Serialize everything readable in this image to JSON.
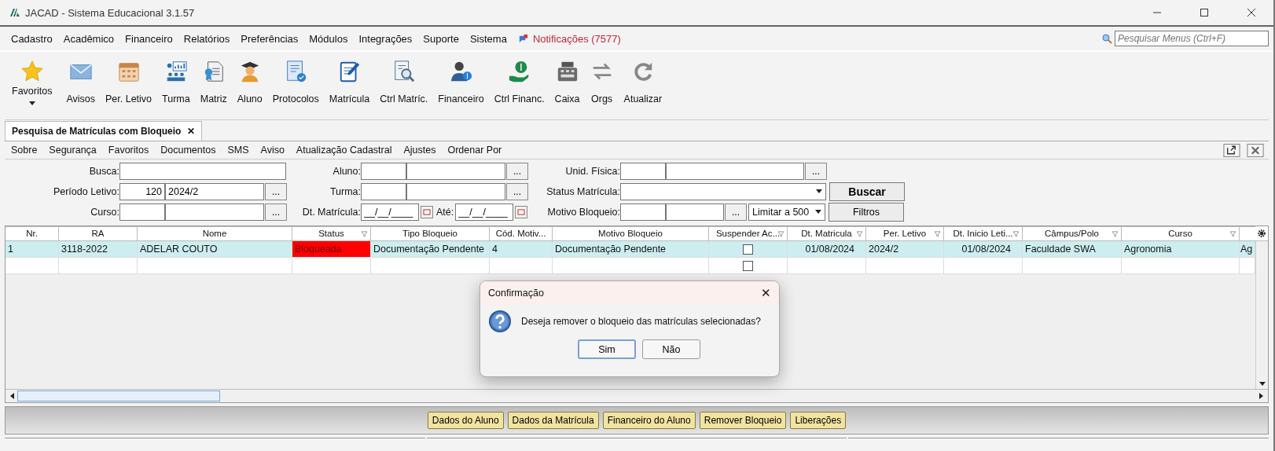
{
  "window": {
    "title": "JACAD - Sistema Educacional 3.1.57"
  },
  "menu": [
    "Cadastro",
    "Acadêmico",
    "Financeiro",
    "Relatórios",
    "Preferências",
    "Módulos",
    "Integrações",
    "Suporte",
    "Sistema"
  ],
  "notifications": "Notificações (7577)",
  "menu_search": {
    "placeholder": "Pesquisar Menus (Ctrl+F)"
  },
  "toolbar": [
    {
      "kind": "star",
      "label": "Favoritos"
    },
    {
      "kind": "mail",
      "label": "Avisos"
    },
    {
      "kind": "calendar",
      "label": "Per. Letivo"
    },
    {
      "kind": "class",
      "label": "Turma"
    },
    {
      "kind": "cert",
      "label": "Matriz"
    },
    {
      "kind": "student",
      "label": "Aluno"
    },
    {
      "kind": "doc",
      "label": "Protocolos"
    },
    {
      "kind": "sign",
      "label": "Matrícula"
    },
    {
      "kind": "inspect",
      "label": "Ctrl Matríc."
    },
    {
      "kind": "finance",
      "label": "Financeiro"
    },
    {
      "kind": "money",
      "label": "Ctrl Financ."
    },
    {
      "kind": "register",
      "label": "Caixa"
    },
    {
      "kind": "swap",
      "label": "Orgs"
    },
    {
      "kind": "refresh",
      "label": "Atualizar"
    }
  ],
  "document_tab": {
    "label": "Pesquisa de Matrículas com Bloqueio",
    "close": "✕"
  },
  "submenu": [
    "Sobre",
    "Segurança",
    "Favoritos",
    "Documentos",
    "SMS",
    "Aviso",
    "Atualização Cadastral",
    "Ajustes",
    "Ordenar Por"
  ],
  "filters": {
    "busca": {
      "label": "Busca:"
    },
    "periodo": {
      "label": "Período Letivo:",
      "code": "120",
      "value": "2024/2",
      "ellipsis": "..."
    },
    "curso": {
      "label": "Curso:",
      "ellipsis": "..."
    },
    "aluno": {
      "label": "Aluno:",
      "ellipsis": "..."
    },
    "turma": {
      "label": "Turma:",
      "ellipsis": "..."
    },
    "dt_matricula": {
      "label": "Dt. Matrícula:",
      "value": "__/__/____"
    },
    "ate": {
      "label": "Até:",
      "value": "__/__/____"
    },
    "unid_fisica": {
      "label": "Unid. Física:",
      "ellipsis": "..."
    },
    "status_matricula": {
      "label": "Status Matrícula:"
    },
    "motivo_bloqueio": {
      "label": "Motivo Bloqueio:",
      "ellipsis": "..."
    },
    "limit": {
      "value": "Limitar a 500"
    },
    "buscar": "Buscar",
    "filtros": "Filtros"
  },
  "table": {
    "columns": [
      {
        "label": "Nr.",
        "filter": false
      },
      {
        "label": "RA",
        "filter": false
      },
      {
        "label": "Nome",
        "filter": false
      },
      {
        "label": "Status",
        "filter": true
      },
      {
        "label": "Tipo Bloqueio",
        "filter": false
      },
      {
        "label": "Cód. Motiv...",
        "filter": false
      },
      {
        "label": "Motivo Bloqueio",
        "filter": false
      },
      {
        "label": "Suspender Ac...",
        "filter": true
      },
      {
        "label": "Dt. Matricula",
        "filter": true
      },
      {
        "label": "Per. Letivo",
        "filter": true
      },
      {
        "label": "Dt. Inicio Leti...",
        "filter": true
      },
      {
        "label": "Câmpus/Polo",
        "filter": true
      },
      {
        "label": "Curso",
        "filter": true
      }
    ],
    "rows": [
      {
        "kind": "data",
        "selected": true,
        "status_alert": true,
        "checked": false,
        "cells": [
          "1",
          "3118-2022",
          "ADELAR COUTO",
          "Bloqueada",
          "Documentação Pendente",
          "4",
          "Documentação Pendente",
          "",
          "01/08/2024",
          "2024/2",
          "01/08/2024",
          "Faculdade SWA",
          "Agronomia",
          "Ag"
        ]
      },
      {
        "kind": "blank",
        "selected": false,
        "status_alert": false,
        "checked": false
      }
    ]
  },
  "dialog": {
    "title": "Confirmação",
    "close": "✕",
    "message": "Deseja remover o bloqueio das matrículas selecionadas?",
    "buttons": [
      {
        "label": "Sim",
        "selected": true
      },
      {
        "label": "Não",
        "selected": false
      }
    ]
  },
  "actions": [
    "Dados do Aluno",
    "Dados da Matrícula",
    "Financeiro do Aluno",
    "Remover Bloqueio",
    "Liberações"
  ]
}
